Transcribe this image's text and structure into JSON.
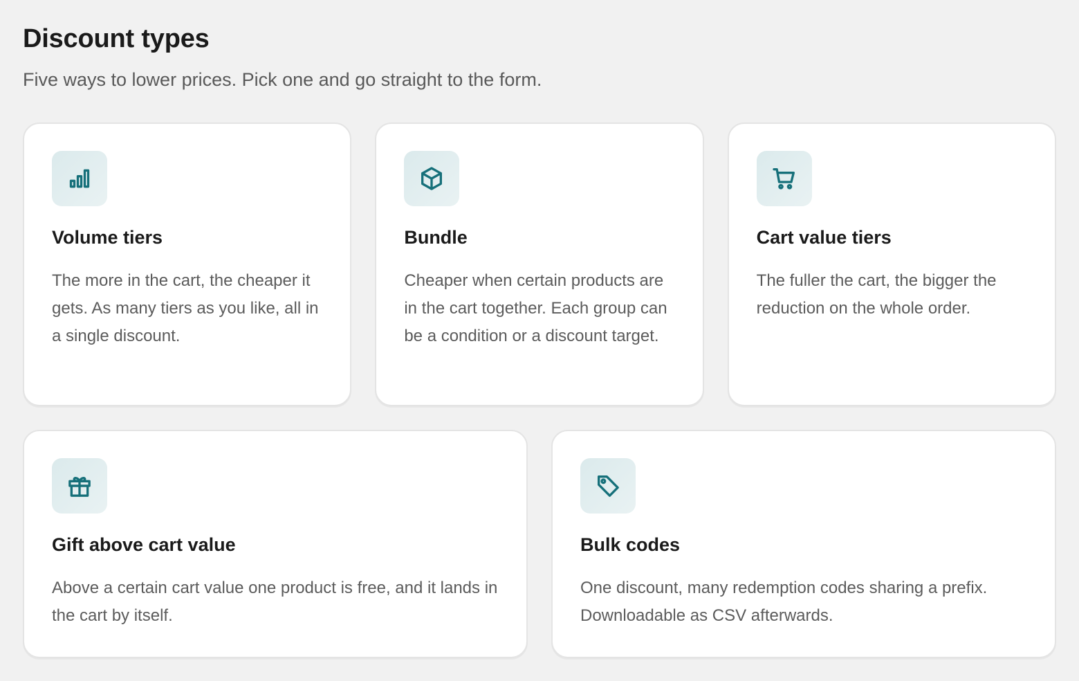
{
  "header": {
    "title": "Discount types",
    "subtitle": "Five ways to lower prices. Pick one and go straight to the form."
  },
  "colors": {
    "background": "#f1f1f1",
    "card": "#ffffff",
    "accent": "#16707a",
    "icon_tile": "#e1eef0"
  },
  "cards": [
    {
      "icon": "bar-chart-icon",
      "title": "Volume tiers",
      "description": "The more in the cart, the cheaper it gets. As many tiers as you like, all in a single discount."
    },
    {
      "icon": "box-icon",
      "title": "Bundle",
      "description": "Cheaper when certain products are in the cart together. Each group can be a condition or a discount target."
    },
    {
      "icon": "shopping-cart-icon",
      "title": "Cart value tiers",
      "description": "The fuller the cart, the bigger the reduction on the whole order."
    },
    {
      "icon": "gift-icon",
      "title": "Gift above cart value",
      "description": "Above a certain cart value one product is free, and it lands in the cart by itself."
    },
    {
      "icon": "tag-icon",
      "title": "Bulk codes",
      "description": "One discount, many redemption codes sharing a prefix. Downloadable as CSV afterwards."
    }
  ]
}
